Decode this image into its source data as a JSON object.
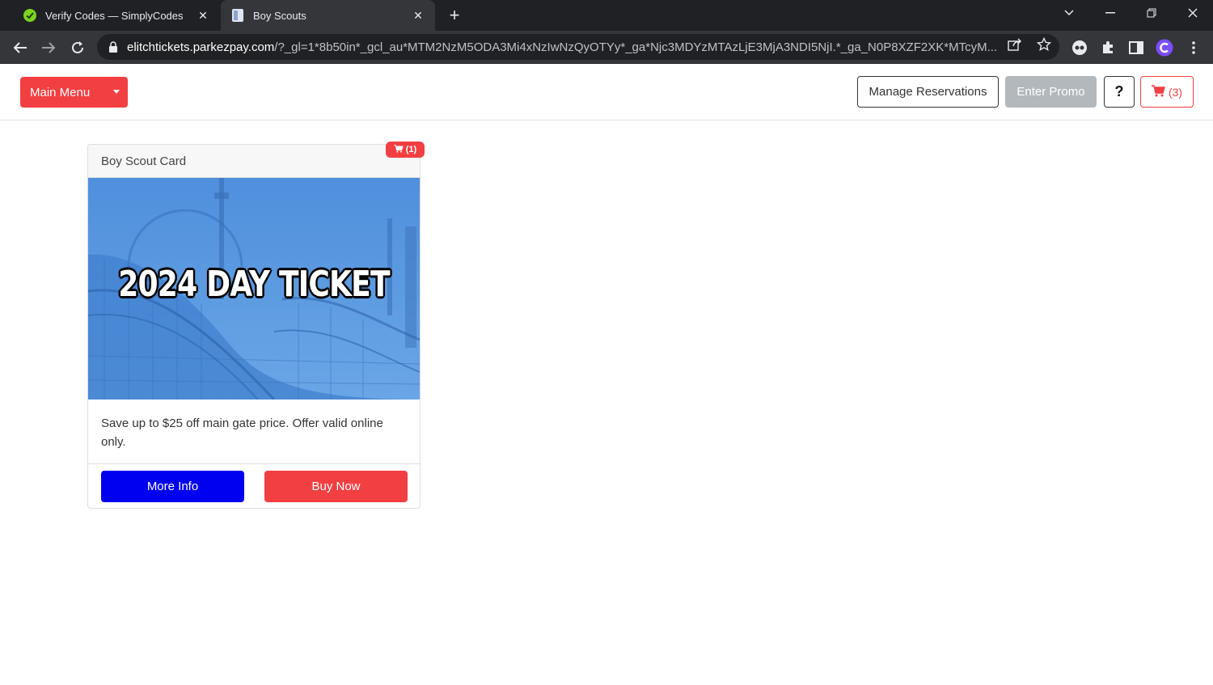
{
  "browser": {
    "tabs": [
      {
        "title": "Verify Codes — SimplyCodes",
        "active": false
      },
      {
        "title": "Boy Scouts",
        "active": true
      }
    ],
    "url_host": "elitchtickets.parkezpay.com",
    "url_rest": "/?_gl=1*8b50in*_gcl_au*MTM2NzM5ODA3Mi4xNzIwNzQyOTYy*_ga*Njc3MDYzMTAzLjE3MjA3NDI5NjI.*_ga_N0P8XZF2XK*MTcyM..."
  },
  "header": {
    "main_menu_label": "Main Menu",
    "manage_label": "Manage Reservations",
    "promo_label": "Enter Promo",
    "help_label": "?",
    "cart_count": "(3)"
  },
  "card": {
    "title": "Boy Scout Card",
    "badge_count": "(1)",
    "image_text": "2024 DAY TICKET",
    "description": "Save up to $25 off main gate price. Offer valid online only.",
    "more_info_label": "More Info",
    "buy_now_label": "Buy Now"
  },
  "colors": {
    "brand_red": "#f23f42",
    "more_info_blue": "#0000f0",
    "promo_gray": "#b3b8bd"
  }
}
